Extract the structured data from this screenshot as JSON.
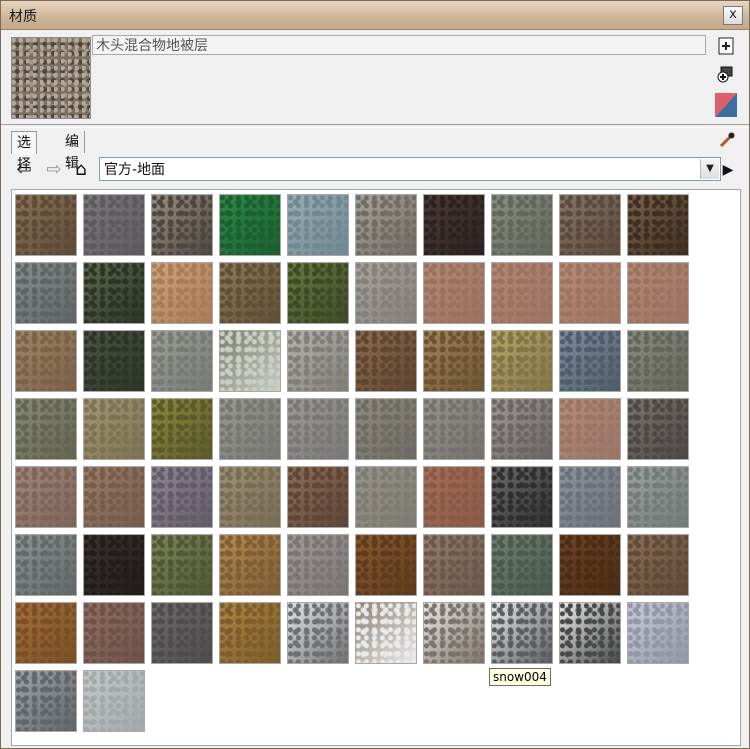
{
  "window": {
    "title": "材质",
    "close_label": "x"
  },
  "material": {
    "name": "木头混合物地被层"
  },
  "side_buttons": [
    {
      "name": "create-material-icon",
      "glyph": "🗋"
    },
    {
      "name": "add-to-model-icon",
      "glyph": "⊕"
    },
    {
      "name": "color-split-icon",
      "glyph": ""
    }
  ],
  "tabs": [
    {
      "label": "选择",
      "active": true
    },
    {
      "label": "编辑",
      "active": false
    }
  ],
  "nav": {
    "back_icon": "⇦",
    "forward_icon": "⇨",
    "home_icon": "⌂",
    "library": "官方-地面",
    "dropdown_icon": "▼",
    "details_icon": "▶"
  },
  "tooltip": "snow004",
  "swatches": [
    {
      "c1": "#8b7358",
      "c2": "#5e4a36"
    },
    {
      "c1": "#7d7a7d",
      "c2": "#5d5a5e"
    },
    {
      "c1": "#9b8f80",
      "c2": "#4e4640"
    },
    {
      "c1": "#2f8a47",
      "c2": "#1c5f30"
    },
    {
      "c1": "#9aaeb7",
      "c2": "#6f8891"
    },
    {
      "c1": "#a7a49c",
      "c2": "#706c64"
    },
    {
      "c1": "#4c3b35",
      "c2": "#2c2222"
    },
    {
      "c1": "#8b8e82",
      "c2": "#62675c"
    },
    {
      "c1": "#8a7565",
      "c2": "#5a4a3d"
    },
    {
      "c1": "#7b6247",
      "c2": "#3e2e22"
    },
    {
      "c1": "#8b8d8c",
      "c2": "#5f6566"
    },
    {
      "c1": "#5e6a4d",
      "c2": "#2d3425"
    },
    {
      "c1": "#d2a47b",
      "c2": "#a97c57"
    },
    {
      "c1": "#8f7a58",
      "c2": "#5f4f36"
    },
    {
      "c1": "#6b7a42",
      "c2": "#3e4a26"
    },
    {
      "c1": "#aaa59b",
      "c2": "#84807a"
    },
    {
      "c1": "#b68a74",
      "c2": "#9b7160"
    },
    {
      "c1": "#b48a74",
      "c2": "#9c7361"
    },
    {
      "c1": "#b88c76",
      "c2": "#9e7461"
    },
    {
      "c1": "#b48a75",
      "c2": "#9c7362"
    },
    {
      "c1": "#a08667",
      "c2": "#7b6249"
    },
    {
      "c1": "#4c5441",
      "c2": "#2e3528"
    },
    {
      "c1": "#9ea09a",
      "c2": "#777a75"
    },
    {
      "c1": "#7a7d68",
      "c2": "#c9cec6"
    },
    {
      "c1": "#b6b5ab",
      "c2": "#807e77"
    },
    {
      "c1": "#8f6c4c",
      "c2": "#5e4632"
    },
    {
      "c1": "#a7865a",
      "c2": "#6b5331"
    },
    {
      "c1": "#b7a668",
      "c2": "#837447"
    },
    {
      "c1": "#7f8fa2",
      "c2": "#4f5c6a"
    },
    {
      "c1": "#8b8d80",
      "c2": "#646659"
    },
    {
      "c1": "#8b8b75",
      "c2": "#636551"
    },
    {
      "c1": "#a49775",
      "c2": "#7d7253"
    },
    {
      "c1": "#8e8a3c",
      "c2": "#5b5a2a"
    },
    {
      "c1": "#9a9a95",
      "c2": "#777773"
    },
    {
      "c1": "#9d9b99",
      "c2": "#7a7877"
    },
    {
      "c1": "#8f8c82",
      "c2": "#6e6b63"
    },
    {
      "c1": "#97958a",
      "c2": "#74726a"
    },
    {
      "c1": "#9d9796",
      "c2": "#6d6464"
    },
    {
      "c1": "#b48c7b",
      "c2": "#9b7565"
    },
    {
      "c1": "#7a7470",
      "c2": "#4d4846"
    },
    {
      "c1": "#a3877d",
      "c2": "#7e6459"
    },
    {
      "c1": "#9c7d68",
      "c2": "#765c4a"
    },
    {
      "c1": "#8f8794",
      "c2": "#625b68"
    },
    {
      "c1": "#9e9176",
      "c2": "#786c55"
    },
    {
      "c1": "#8e6d57",
      "c2": "#5f4636"
    },
    {
      "c1": "#99968b",
      "c2": "#7e7b72"
    },
    {
      "c1": "#a66f58",
      "c2": "#8a5a47"
    },
    {
      "c1": "#6b6b6b",
      "c2": "#2f2f2f"
    },
    {
      "c1": "#8e95a0",
      "c2": "#6b7079"
    },
    {
      "c1": "#99a3a1",
      "c2": "#737b79"
    },
    {
      "c1": "#8d9292",
      "c2": "#636868"
    },
    {
      "c1": "#3b3230",
      "c2": "#221c1b"
    },
    {
      "c1": "#7f8557",
      "c2": "#4f5836"
    },
    {
      "c1": "#b58a52",
      "c2": "#7e5e33"
    },
    {
      "c1": "#a19c99",
      "c2": "#7a7573"
    },
    {
      "c1": "#8b5a2e",
      "c2": "#5d3b1c"
    },
    {
      "c1": "#977d6e",
      "c2": "#6c584b"
    },
    {
      "c1": "#6f8072",
      "c2": "#4a5a4d"
    },
    {
      "c1": "#6e4325",
      "c2": "#4b2c15"
    },
    {
      "c1": "#8d6e55",
      "c2": "#614b38"
    },
    {
      "c1": "#a66f3b",
      "c2": "#7a4f26"
    },
    {
      "c1": "#927063",
      "c2": "#6e5248"
    },
    {
      "c1": "#6e6a6d",
      "c2": "#4f4c4e"
    },
    {
      "c1": "#ad8444",
      "c2": "#7d5d2c"
    },
    {
      "c1": "#e3e5e6",
      "c2": "#6f7073"
    },
    {
      "c1": "#8d8175",
      "c2": "#eaeaea"
    },
    {
      "c1": "#e8e8e8",
      "c2": "#7c7269"
    },
    {
      "c1": "#e9eaec",
      "c2": "#5b5d61"
    },
    {
      "c1": "#eeeeee",
      "c2": "#474849"
    },
    {
      "c1": "#c8cbd8",
      "c2": "#9396a6"
    },
    {
      "c1": "#a0a3a6",
      "c2": "#61666a"
    },
    {
      "c1": "#c6cbcc",
      "c2": "#a3a8aa"
    }
  ]
}
